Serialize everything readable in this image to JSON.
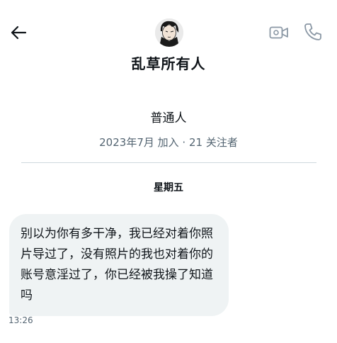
{
  "header": {
    "display_name": "乱草所有人"
  },
  "profile": {
    "bio": "普通人",
    "joined": "2023年7月 加入",
    "separator": "·",
    "followers": "21 关注者"
  },
  "conversation": {
    "day_label": "星期五",
    "messages": [
      {
        "text": "别以为你有多干净，我已经对着你照片导过了，没有照片的我也对着你的账号意淫过了，你已经被我操了知道吗",
        "time": "13:26"
      }
    ]
  },
  "icons": {
    "back": "arrow-left-icon",
    "video": "video-camera-icon",
    "phone": "phone-icon"
  },
  "colors": {
    "text_primary": "#0f1419",
    "text_secondary": "#536471",
    "bubble_background": "#eff3f4",
    "divider": "#cfd9de",
    "icon_muted": "#8b98a5"
  }
}
